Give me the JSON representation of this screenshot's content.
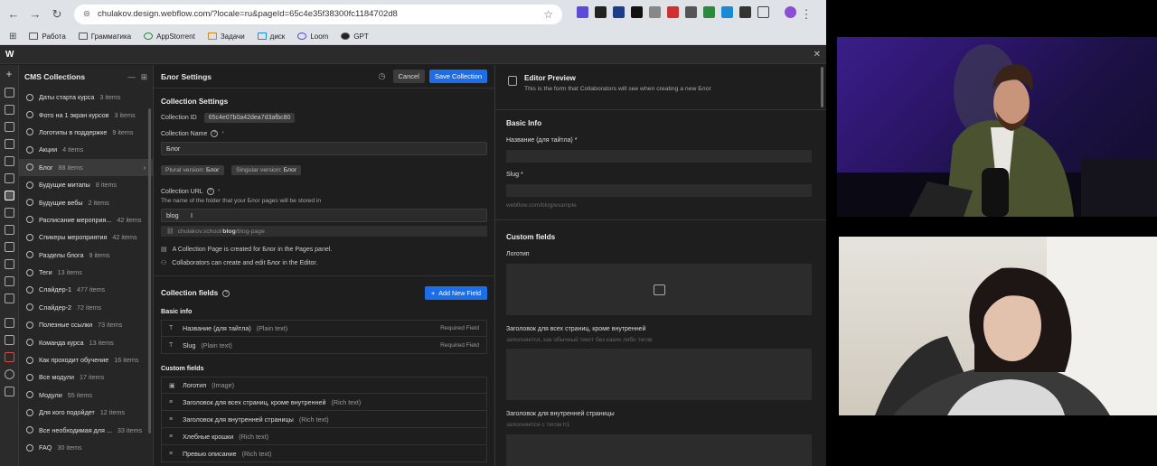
{
  "browser": {
    "url": "chulakov.design.webflow.com/?locale=ru&pageId=65c4e35f38300fc1184702d8",
    "bookmarks": [
      "Работа",
      "Грамматика",
      "AppStorrent",
      "Задачи",
      "диск",
      "Loom",
      "GPT"
    ]
  },
  "collections": {
    "title": "CMS Collections",
    "items": [
      {
        "name": "Даты старта курса",
        "count": "3 items"
      },
      {
        "name": "Фото на 1 экран курсов",
        "count": "3 items"
      },
      {
        "name": "Логотипы в поддержке",
        "count": "9 items"
      },
      {
        "name": "Акции",
        "count": "4 items"
      },
      {
        "name": "Блог",
        "count": "88 items"
      },
      {
        "name": "Будущие митапы",
        "count": "8 items"
      },
      {
        "name": "Будущие вебы",
        "count": "2 items"
      },
      {
        "name": "Расписание мероприя...",
        "count": "42 items"
      },
      {
        "name": "Спикеры мероприятия",
        "count": "42 items"
      },
      {
        "name": "Разделы блога",
        "count": "9 items"
      },
      {
        "name": "Теги",
        "count": "13 items"
      },
      {
        "name": "Слайдер-1",
        "count": "477 items"
      },
      {
        "name": "Слайдер-2",
        "count": "72 items"
      },
      {
        "name": "Полезные ссылки",
        "count": "73 items"
      },
      {
        "name": "Команда курса",
        "count": "13 items"
      },
      {
        "name": "Как проходит обучение",
        "count": "16 items"
      },
      {
        "name": "Все модули",
        "count": "17 items"
      },
      {
        "name": "Модули",
        "count": "55 items"
      },
      {
        "name": "Для кого подойдет",
        "count": "12 items"
      },
      {
        "name": "Все необходимая для ...",
        "count": "33 items"
      },
      {
        "name": "FAQ",
        "count": "30 items"
      }
    ]
  },
  "settings": {
    "title": "Блог Settings",
    "cancel": "Cancel",
    "save": "Save Collection",
    "section_title": "Collection Settings",
    "id_label": "Collection ID",
    "id_value": "65c4e07b0a42dea7d3afbc80",
    "name_label": "Collection Name",
    "name_value": "Блог",
    "plural_label": "Plural version:",
    "plural_value": "Блог",
    "singular_label": "Singular version:",
    "singular_value": "Блог",
    "url_label": "Collection URL",
    "url_hint": "The name of the folder that your Блог pages will be stored in",
    "url_value": "blog",
    "url_preview_domain": "chulakov.school/",
    "url_preview_bold": "blog",
    "url_preview_rest": "/blog-page",
    "note1": "A Collection Page is created for Блог in the Pages panel.",
    "note2": "Collaborators can create and edit Блог in the Editor.",
    "fields_title": "Collection fields",
    "add_field": "Add New Field",
    "basic_info": "Basic info",
    "basic_fields": [
      {
        "name": "Название (для тайтла)",
        "type": "(Plain text)",
        "req": "Required Field",
        "icon": "T"
      },
      {
        "name": "Slug",
        "type": "(Plain text)",
        "req": "Required Field",
        "icon": "T"
      }
    ],
    "custom_fields_title": "Custom fields",
    "custom_fields": [
      {
        "name": "Логотип",
        "type": "(Image)",
        "icon": "▣"
      },
      {
        "name": "Заголовок для всех страниц, кроме внутренней",
        "type": "(Rich text)",
        "icon": "≡"
      },
      {
        "name": "Заголовок для внутренней страницы",
        "type": "(Rich text)",
        "icon": "≡"
      },
      {
        "name": "Хлебные крошки",
        "type": "(Rich text)",
        "icon": "≡"
      },
      {
        "name": "Превью описание",
        "type": "(Rich text)",
        "icon": "≡"
      }
    ]
  },
  "preview": {
    "title": "Editor Preview",
    "subtitle": "This is the form that Collaborators will see when creating a new Блог",
    "basic_info": "Basic Info",
    "name_label": "Название (для тайтла) *",
    "slug_label": "Slug *",
    "slug_hint": "webflow.com/blog/example",
    "custom_fields": "Custom fields",
    "logo_label": "Логотип",
    "heading_all_label": "Заголовок для всех страниц, кроме внутренней",
    "heading_all_hint": "заполняется, как обычный текст без каких либо тегов",
    "heading_inner_label": "Заголовок для внутренней страницы",
    "heading_inner_hint": "заполняется с тегом h1"
  },
  "colors": {
    "accent": "#1b6ee8",
    "required": "#e04848",
    "panel": "#1e1e1e"
  }
}
